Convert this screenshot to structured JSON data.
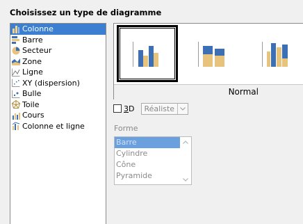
{
  "heading": "Choisissez un type de diagramme",
  "chart_types": [
    {
      "label": "Colonne",
      "icon": "column-chart-icon"
    },
    {
      "label": "Barre",
      "icon": "bar-chart-icon"
    },
    {
      "label": "Secteur",
      "icon": "pie-chart-icon"
    },
    {
      "label": "Zone",
      "icon": "area-chart-icon"
    },
    {
      "label": "Ligne",
      "icon": "line-chart-icon"
    },
    {
      "label": "XY (dispersion)",
      "icon": "scatter-chart-icon"
    },
    {
      "label": "Bulle",
      "icon": "bubble-chart-icon"
    },
    {
      "label": "Toile",
      "icon": "net-chart-icon"
    },
    {
      "label": "Cours",
      "icon": "stock-chart-icon"
    },
    {
      "label": "Colonne et ligne",
      "icon": "column-line-chart-icon"
    }
  ],
  "selected_type": "Colonne",
  "variant_caption": "Normal",
  "three_d": {
    "label_prefix": "",
    "label_underlined": "3",
    "label_suffix": "D",
    "checked": false
  },
  "render_style": {
    "value": "Réaliste",
    "enabled": false
  },
  "shape": {
    "label": "Forme",
    "options": [
      "Barre",
      "Cylindre",
      "Cône",
      "Pyramide"
    ],
    "selected": "Barre",
    "enabled": false
  },
  "colors": {
    "selection": "#3c7fd1",
    "bar_blue": "#3c6fb4",
    "bar_tan": "#e8c37e"
  }
}
